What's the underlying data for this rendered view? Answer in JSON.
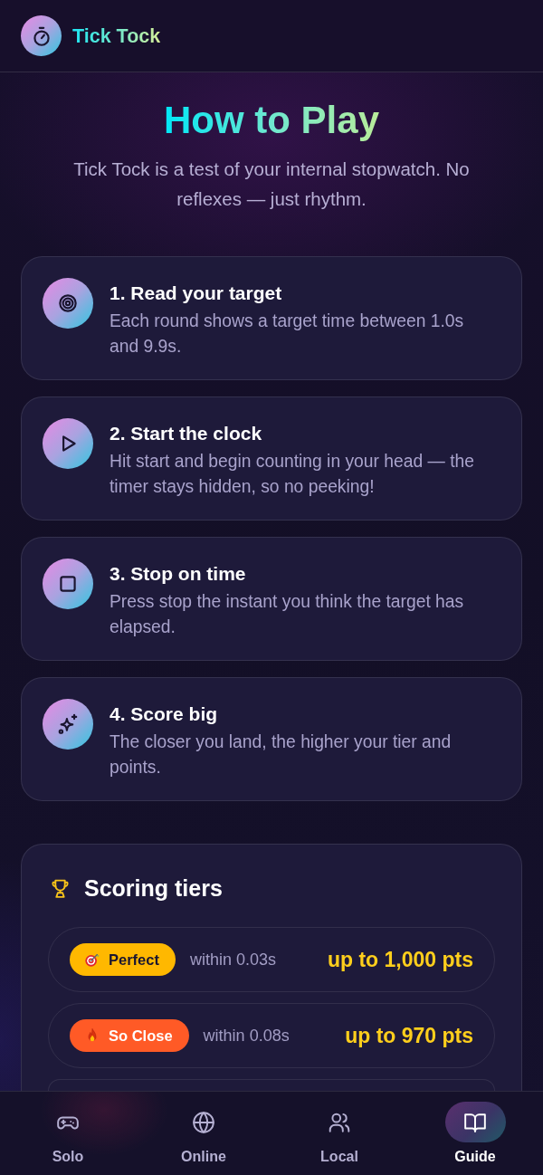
{
  "app": {
    "name": "Tick Tock"
  },
  "intro": {
    "title": "How to Play",
    "subtitle": "Tick Tock is a test of your internal stopwatch. No reflexes — just rhythm."
  },
  "steps": [
    {
      "title": "1. Read your target",
      "description": "Each round shows a target time between 1.0s and 9.9s."
    },
    {
      "title": "2. Start the clock",
      "description": "Hit start and begin counting in your head — the timer stays hidden, so no peeking!"
    },
    {
      "title": "3. Stop on time",
      "description": "Press stop the instant you think the target has elapsed."
    },
    {
      "title": "4. Score big",
      "description": "The closer you land, the higher your tier and points."
    }
  ],
  "scoring": {
    "title": "Scoring tiers",
    "tiers": [
      {
        "label": "Perfect",
        "color": "#ffb800",
        "range": "within 0.03s",
        "points": "up to 1,000 pts"
      },
      {
        "label": "So Close",
        "color": "#ff5a26",
        "range": "within 0.08s",
        "points": "up to 970 pts"
      }
    ]
  },
  "nav": [
    {
      "label": "Solo",
      "selected": false
    },
    {
      "label": "Online",
      "selected": false
    },
    {
      "label": "Local",
      "selected": false
    },
    {
      "label": "Guide",
      "selected": true
    }
  ]
}
